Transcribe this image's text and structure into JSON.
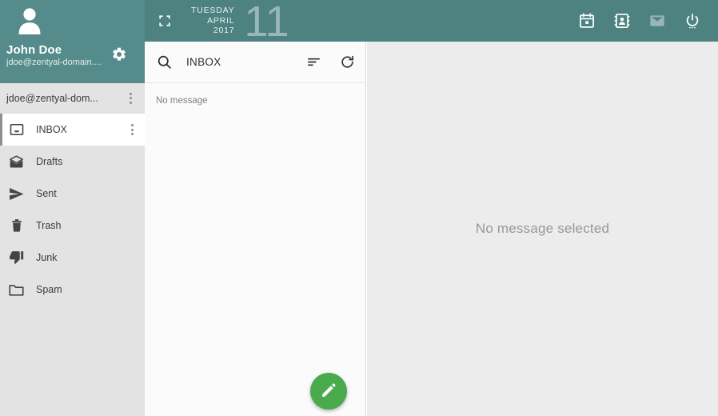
{
  "topbar": {
    "fullscreen_icon": "fullscreen-icon",
    "date": {
      "weekday": "TUESDAY",
      "month": "APRIL",
      "year": "2017",
      "day": "11"
    },
    "apps": [
      {
        "name": "calendar-app-icon",
        "label": "Calendar",
        "active": false
      },
      {
        "name": "contacts-app-icon",
        "label": "Contacts",
        "active": false
      },
      {
        "name": "mail-app-icon",
        "label": "Mail",
        "active": true
      },
      {
        "name": "power-icon",
        "label": "Power",
        "active": false
      }
    ],
    "background_color": "#4d8281"
  },
  "sidebar": {
    "user": {
      "avatar_icon": "user-avatar-icon",
      "name": "John Doe",
      "email": "jdoe@zentyal-domain....",
      "settings_icon": "gear-icon"
    },
    "account": {
      "label": "jdoe@zentyal-dom...",
      "menu_icon": "kebab-menu-icon"
    },
    "folders": [
      {
        "label": "INBOX",
        "icon": "inbox-icon",
        "active": true,
        "has_menu": true
      },
      {
        "label": "Drafts",
        "icon": "drafts-icon",
        "active": false,
        "has_menu": false
      },
      {
        "label": "Sent",
        "icon": "sent-icon",
        "active": false,
        "has_menu": false
      },
      {
        "label": "Trash",
        "icon": "trash-icon",
        "active": false,
        "has_menu": false
      },
      {
        "label": "Junk",
        "icon": "junk-icon",
        "active": false,
        "has_menu": false
      },
      {
        "label": "Spam",
        "icon": "folder-icon",
        "active": false,
        "has_menu": false
      }
    ],
    "background_color": "#e3e3e3",
    "user_panel_color": "#558b8a"
  },
  "message_list": {
    "search_icon": "search-icon",
    "title": "INBOX",
    "sort_icon": "sort-icon",
    "refresh_icon": "refresh-icon",
    "empty_text": "No message",
    "compose": {
      "icon": "pencil-icon",
      "color": "#49ab4b"
    }
  },
  "reading_pane": {
    "empty_text": "No message selected"
  }
}
